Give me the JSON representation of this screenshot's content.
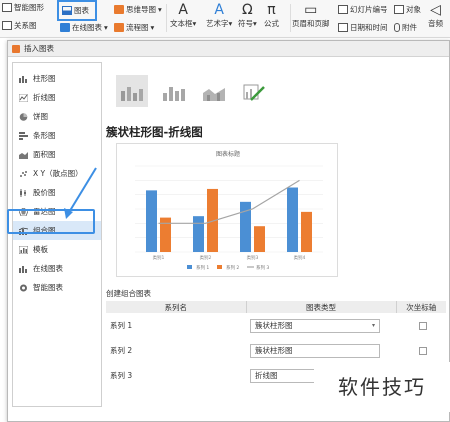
{
  "ribbon": {
    "smart_graphic": "智能图形",
    "chart": "图表",
    "mind_map": "思维导图",
    "text_box": "文本框",
    "art_text": "艺术字",
    "symbol": "符号",
    "formula": "公式",
    "slide_number": "幻灯片编号",
    "object": "对象",
    "header_footer": "页眉和页脚",
    "date_time": "日期和时间",
    "attachment": "附件",
    "audio": "音频",
    "relation_graph": "关系图",
    "online_chart": "在线图表",
    "flowchart": "流程图",
    "dropdown_caret": "▾",
    "text_box_caret": "▾",
    "art_text_caret": "▾",
    "symbol_caret": "▾",
    "symbol_glyph": "Ω",
    "formula_glyph": "π",
    "text_box_glyph": "A",
    "art_text_glyph": "A"
  },
  "dialog": {
    "title": "插入图表",
    "nav": [
      {
        "label": "柱形图",
        "icon": "column-chart-icon",
        "color": "#555555"
      },
      {
        "label": "折线图",
        "icon": "line-chart-icon",
        "color": "#555555"
      },
      {
        "label": "饼图",
        "icon": "pie-chart-icon",
        "color": "#555555"
      },
      {
        "label": "条形图",
        "icon": "bar-chart-icon",
        "color": "#555555"
      },
      {
        "label": "面积图",
        "icon": "area-chart-icon",
        "color": "#555555"
      },
      {
        "label": "X Y（散点图）",
        "icon": "scatter-chart-icon",
        "color": "#555555"
      },
      {
        "label": "股价图",
        "icon": "stock-chart-icon",
        "color": "#555555"
      },
      {
        "label": "雷达图",
        "icon": "radar-chart-icon",
        "color": "#555555"
      },
      {
        "label": "组合图",
        "icon": "combo-chart-icon",
        "color": "#555555"
      },
      {
        "label": "模板",
        "icon": "template-icon",
        "color": "#555555"
      },
      {
        "label": "在线图表",
        "icon": "online-chart-icon",
        "color": "#555555"
      },
      {
        "label": "智能图表",
        "icon": "smart-chart-icon",
        "color": "#555555"
      }
    ],
    "selected_type_title": "簇状柱形图-折线图",
    "combo_section_label": "创建组合图表",
    "table": {
      "headers": [
        "系列名",
        "图表类型",
        "次坐标轴"
      ],
      "rows": [
        {
          "name": "系列 1",
          "type": "簇状柱形图",
          "caret": "▾"
        },
        {
          "name": "系列 2",
          "type": "簇状柱形图",
          "caret": ""
        },
        {
          "name": "系列 3",
          "type": "折线图",
          "caret": ""
        }
      ]
    }
  },
  "chart_data": {
    "type": "bar",
    "title": "图表标题",
    "categories": [
      "类别1",
      "类别2",
      "类别3",
      "类别4"
    ],
    "series": [
      {
        "name": "系列 1",
        "type": "bar",
        "color": "#4b8fd4",
        "values": [
          4.3,
          2.5,
          3.5,
          4.5
        ]
      },
      {
        "name": "系列 2",
        "type": "bar",
        "color": "#ec7d31",
        "values": [
          2.4,
          4.4,
          1.8,
          2.8
        ]
      },
      {
        "name": "系列 3",
        "type": "line",
        "color": "#a5a5a5",
        "values": [
          2,
          2,
          3,
          5
        ]
      }
    ],
    "ylim": [
      0,
      6
    ],
    "grid": true,
    "legend": "bottom"
  },
  "watermark": "软件技巧",
  "colors": {
    "accent": "#3d8fe4",
    "selected_bg": "#d9e8f8"
  }
}
